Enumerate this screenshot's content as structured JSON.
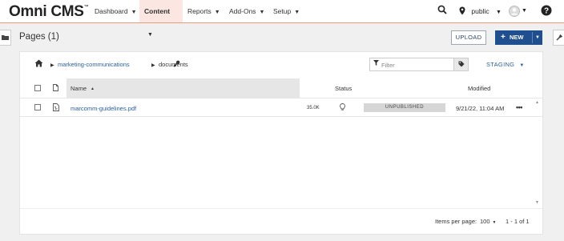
{
  "app": {
    "logo": "Omni CMS",
    "logo_mark": "™"
  },
  "nav": {
    "items": [
      {
        "label": "Dashboard",
        "active": false
      },
      {
        "label": "Content",
        "active": true
      },
      {
        "label": "Reports",
        "active": false
      },
      {
        "label": "Add-Ons",
        "active": false
      },
      {
        "label": "Setup",
        "active": false
      }
    ],
    "site_label": "public",
    "icons": [
      "search-icon",
      "location-pin-icon",
      "avatar-icon",
      "help-icon"
    ]
  },
  "page": {
    "title": "Pages (1)",
    "upload_label": "UPLOAD",
    "new_label": "NEW"
  },
  "breadcrumb": {
    "items": [
      "marketing-communications",
      "documents"
    ]
  },
  "filter": {
    "placeholder": "Filter"
  },
  "environment": "STAGING",
  "table": {
    "columns": {
      "name": "Name",
      "status": "Status",
      "modified": "Modified"
    },
    "sort": {
      "column": "name",
      "direction": "ascending"
    },
    "rows": [
      {
        "name": "marcomm-guidelines.pdf",
        "size": "35.0K",
        "status": "UNPUBLISHED",
        "modified": "9/21/22, 11:04 AM"
      }
    ]
  },
  "pagination": {
    "items_per_page_label": "Items per page:",
    "items_per_page": "100",
    "range": "1 - 1 of 1"
  },
  "colors": {
    "accent": "#1f4f8f",
    "link": "#2a5f9e",
    "nav_active": "#fbe6e1",
    "nav_border": "#e89a7a"
  }
}
